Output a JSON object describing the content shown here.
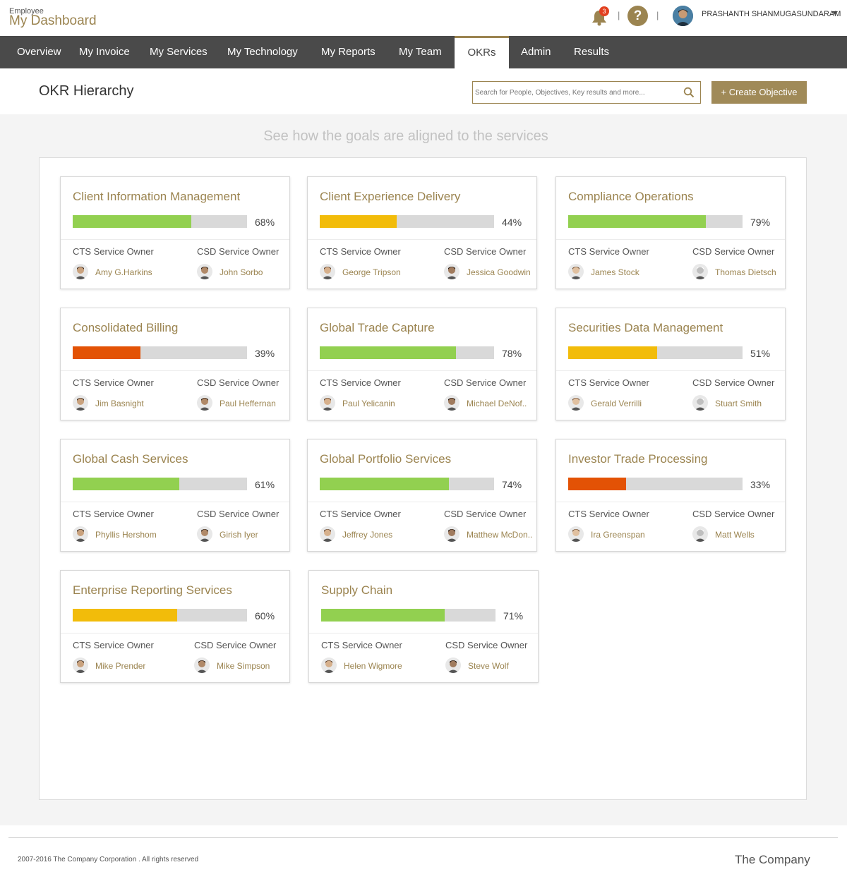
{
  "header": {
    "brand_small": "Employee",
    "brand_big": "My Dashboard",
    "notification_count": "3",
    "help_label": "?",
    "user_name": "PRASHANTH SHANMUGASUNDARAM"
  },
  "nav": {
    "items": [
      "Overview",
      "My Invoice",
      "My Services",
      "My Technology",
      "My Reports",
      "My Team",
      "OKRs",
      "Admin",
      "Results"
    ],
    "active": "OKRs"
  },
  "page": {
    "title": "OKR Hierarchy",
    "search_placeholder": "Search for People, Objectives, Key results and more...",
    "create_label": "+ Create Objective",
    "subtitle": "See how the goals are aligned to the services"
  },
  "labels": {
    "cts": "CTS Service Owner",
    "csd": "CSD Service Owner"
  },
  "colors": {
    "accent": "#9b8450",
    "green": "#92d050",
    "yellow": "#f2bc0a",
    "red": "#e35205",
    "nav_bg": "#4a4a4a"
  },
  "cards": [
    {
      "title": "Client Information Management",
      "progress": 68,
      "pct": "68%",
      "status": "green",
      "cts_name": "Amy G.Harkins",
      "csd_name": "John Sorbo"
    },
    {
      "title": "Client Experience Delivery",
      "progress": 44,
      "pct": "44%",
      "status": "yellow",
      "cts_name": "George Tripson",
      "csd_name": "Jessica Goodwin"
    },
    {
      "title": "Compliance Operations",
      "progress": 79,
      "pct": "79%",
      "status": "green",
      "cts_name": "James Stock",
      "csd_name": "Thomas Dietsch"
    },
    {
      "title": "Consolidated Billing",
      "progress": 39,
      "pct": "39%",
      "status": "red",
      "cts_name": "Jim Basnight",
      "csd_name": "Paul Heffernan"
    },
    {
      "title": "Global Trade Capture",
      "progress": 78,
      "pct": "78%",
      "status": "green",
      "cts_name": "Paul Yelicanin",
      "csd_name": "Michael DeNof.."
    },
    {
      "title": "Securities Data Management",
      "progress": 51,
      "pct": "51%",
      "status": "yellow",
      "cts_name": "Gerald Verrilli",
      "csd_name": "Stuart Smith"
    },
    {
      "title": "Global Cash Services",
      "progress": 61,
      "pct": "61%",
      "status": "green",
      "cts_name": "Phyllis Hershom",
      "csd_name": "Girish Iyer"
    },
    {
      "title": "Global Portfolio Services",
      "progress": 74,
      "pct": "74%",
      "status": "green",
      "cts_name": "Jeffrey Jones",
      "csd_name": "Matthew McDon.."
    },
    {
      "title": "Investor Trade Processing",
      "progress": 33,
      "pct": "33%",
      "status": "red",
      "cts_name": "Ira Greenspan",
      "csd_name": "Matt Wells"
    },
    {
      "title": "Enterprise Reporting Services",
      "progress": 60,
      "pct": "60%",
      "status": "yellow",
      "cts_name": "Mike Prender",
      "csd_name": "Mike Simpson"
    },
    {
      "title": "Supply Chain",
      "progress": 71,
      "pct": "71%",
      "status": "green",
      "cts_name": "Helen Wigmore",
      "csd_name": "Steve Wolf"
    }
  ],
  "footer": {
    "copyright": "2007-2016 The Company Corporation . All rights reserved",
    "brand": "The Company"
  }
}
